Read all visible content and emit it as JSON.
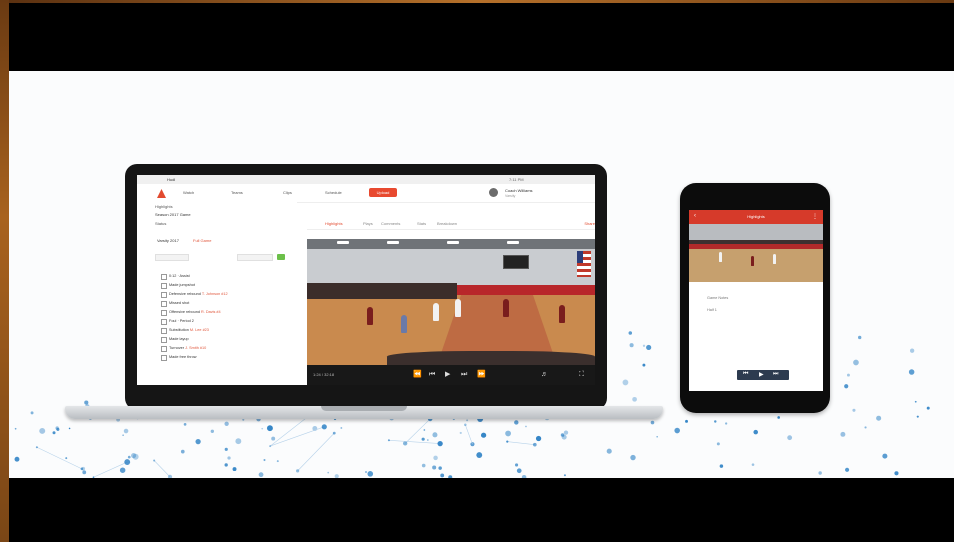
{
  "app": {
    "window_title": "Hudl",
    "status": "7:11 PM"
  },
  "nav": {
    "items": [
      "Watch",
      "Teams",
      "Clips",
      "Schedule"
    ],
    "upload_label": "Upload",
    "user_name": "Coach Williams",
    "team_name": "Varsity"
  },
  "left_panel": {
    "field_labels": [
      "Highlights",
      "Season 2017 Game",
      "Status"
    ],
    "event_title": "Varsity 2017",
    "event_subtitle": "Full Game",
    "events": [
      {
        "text": "0:12 · Assist",
        "highlight": ""
      },
      {
        "text": "Made jumpshot",
        "highlight": ""
      },
      {
        "text": "Defensive rebound",
        "highlight": "T. Johnson #12"
      },
      {
        "text": "Missed shot",
        "highlight": ""
      },
      {
        "text": "Offensive rebound",
        "highlight": "R. Davis #4"
      },
      {
        "text": "Foul · Period 2",
        "highlight": ""
      },
      {
        "text": "Substitution",
        "highlight": "M. Lee #23"
      },
      {
        "text": "Made layup",
        "highlight": ""
      },
      {
        "text": "Turnover",
        "highlight": "J. Smith #10"
      },
      {
        "text": "Made free throw",
        "highlight": ""
      }
    ]
  },
  "tabs": {
    "items": [
      "Highlights",
      "Plays",
      "Comments",
      "Stats",
      "Breakdown"
    ],
    "active_index": 0,
    "share_label": "Share"
  },
  "player": {
    "time": "1:24 / 32:18",
    "controls": [
      "rewind",
      "previous",
      "play",
      "next",
      "forward"
    ]
  },
  "phone": {
    "title": "Highlights",
    "lines": [
      "Game Notes",
      "Half 1"
    ]
  },
  "colors": {
    "accent": "#e24a2f",
    "link_red": "#e0553a",
    "phone_header": "#d63a2a",
    "dots": "#2a7fc4"
  }
}
